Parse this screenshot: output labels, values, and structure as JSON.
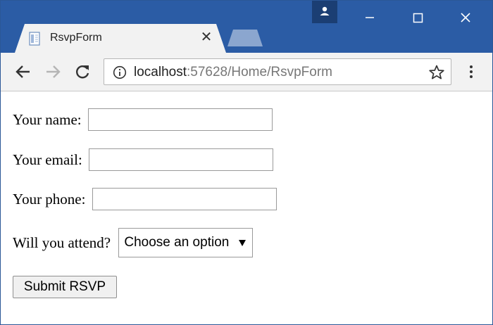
{
  "browser": {
    "tab": {
      "title": "RsvpForm",
      "close_glyph": "✕"
    },
    "address_bar": {
      "host": "localhost",
      "rest": ":57628/Home/RsvpForm"
    },
    "icons": {
      "favicon": "document-icon",
      "profile": "profile-icon",
      "minimize": "minimize-icon",
      "maximize": "maximize-icon",
      "close_window": "close-icon",
      "back": "back-arrow-icon",
      "forward": "forward-arrow-icon",
      "reload": "reload-icon",
      "info": "info-icon",
      "bookmark": "star-icon",
      "menu": "menu-dots-icon"
    },
    "colors": {
      "titlebar": "#2b5ca5",
      "tab": "#f2f2f2",
      "toolbar": "#f2f2f2"
    }
  },
  "form": {
    "name_label": "Your name:",
    "name_value": "",
    "email_label": "Your email:",
    "email_value": "",
    "phone_label": "Your phone:",
    "phone_value": "",
    "attend_label": "Will you attend?",
    "attend_selected": "Choose an option",
    "submit_label": "Submit RSVP"
  }
}
